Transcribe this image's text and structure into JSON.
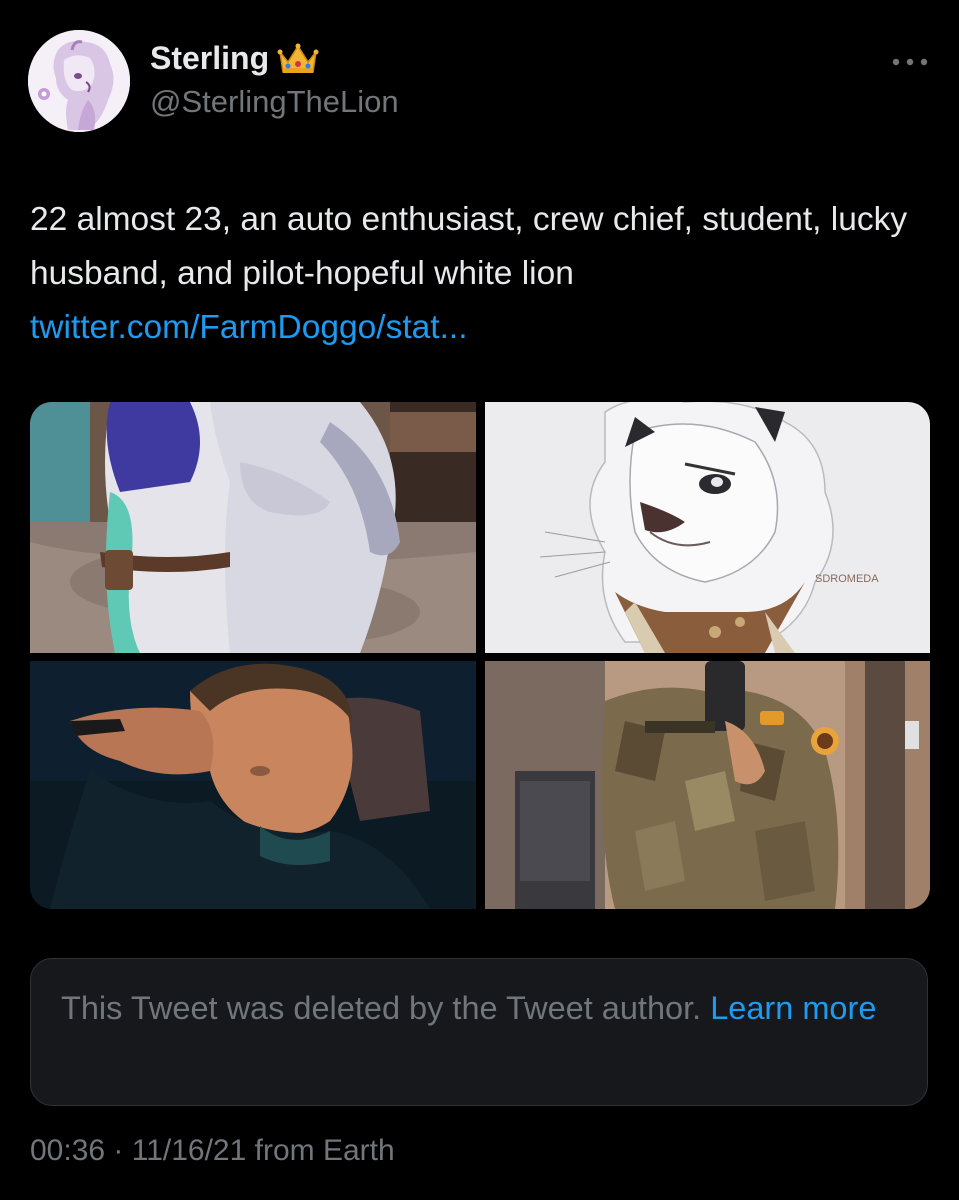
{
  "author": {
    "display_name": "Sterling",
    "badge_icon": "crown-icon",
    "handle": "@SterlingTheLion"
  },
  "tweet": {
    "text_before_link": "22 almost 23, an auto enthusiast, crew chief, student, lucky husband, and pilot-hopeful white lion ",
    "link_text": "twitter.com/FarmDoggo/stat..."
  },
  "media": {
    "tiles": [
      "fursuit-hug-photo",
      "white-lion-drawing",
      "selfie-in-car-photo",
      "uniform-mirror-selfie-photo"
    ],
    "artist_signature": "SDROMEDA"
  },
  "quoted_tweet": {
    "notice": "This Tweet was deleted by the Tweet author. ",
    "learn_more": "Learn more"
  },
  "meta": {
    "time": "00:36",
    "separator": " · ",
    "date": "11/16/21",
    "source": " from Earth"
  },
  "colors": {
    "background": "#000000",
    "text": "#e7e9ea",
    "secondary_text": "#71767b",
    "link": "#1d9bf0",
    "card_border": "#2f3336"
  }
}
